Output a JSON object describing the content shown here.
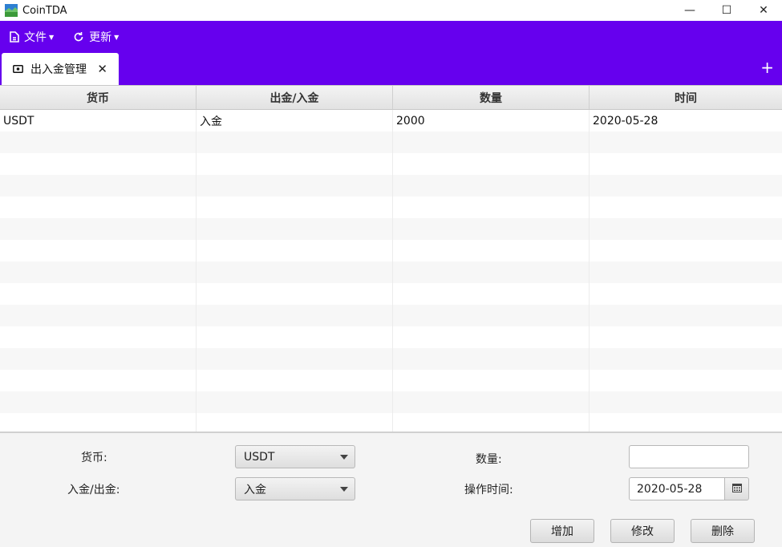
{
  "app": {
    "title": "CoinTDA",
    "window_controls": {
      "minimize": "—",
      "maximize": "☐",
      "close": "✕"
    }
  },
  "menu": [
    {
      "label": "文件",
      "icon": "file-icon"
    },
    {
      "label": "更新",
      "icon": "refresh-icon"
    }
  ],
  "tabs": [
    {
      "label": "出入金管理",
      "icon": "money-icon",
      "close": "✕"
    }
  ],
  "add_tab_label": "+",
  "table": {
    "columns": [
      "货币",
      "出金/入金",
      "数量",
      "时间"
    ],
    "rows": [
      [
        "USDT",
        "入金",
        "2000",
        "2020-05-28"
      ],
      [
        "",
        "",
        "",
        ""
      ],
      [
        "",
        "",
        "",
        ""
      ],
      [
        "",
        "",
        "",
        ""
      ],
      [
        "",
        "",
        "",
        ""
      ],
      [
        "",
        "",
        "",
        ""
      ],
      [
        "",
        "",
        "",
        ""
      ],
      [
        "",
        "",
        "",
        ""
      ],
      [
        "",
        "",
        "",
        ""
      ],
      [
        "",
        "",
        "",
        ""
      ],
      [
        "",
        "",
        "",
        ""
      ],
      [
        "",
        "",
        "",
        ""
      ],
      [
        "",
        "",
        "",
        ""
      ],
      [
        "",
        "",
        "",
        ""
      ],
      [
        "",
        "",
        "",
        ""
      ]
    ]
  },
  "form": {
    "currency_label": "货币:",
    "currency_value": "USDT",
    "direction_label": "入金/出金:",
    "direction_value": "入金",
    "quantity_label": "数量:",
    "quantity_value": "",
    "time_label": "操作时间:",
    "time_value": "2020-05-28"
  },
  "buttons": {
    "add": "增加",
    "edit": "修改",
    "delete": "删除"
  },
  "colors": {
    "header_purple": "#6600ee"
  }
}
